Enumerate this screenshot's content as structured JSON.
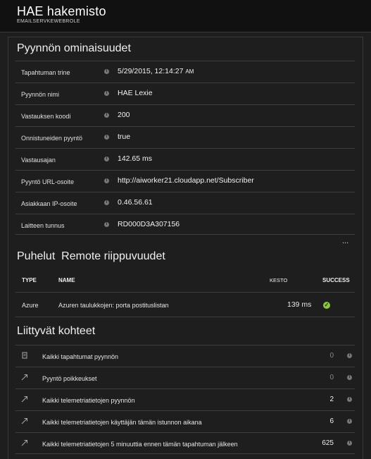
{
  "header": {
    "title": "HAE hakemisto",
    "subtitle": "EMAILSERVKEWEBROLE"
  },
  "properties": {
    "title": "Pyynnön ominaisuudet",
    "rows": [
      {
        "label": "Tapahtuman trine",
        "value": "5/29/2015, 12:14:27",
        "suffix": "AM"
      },
      {
        "label": "Pyynnön nimi",
        "value": "HAE Lexie"
      },
      {
        "label": "Vastauksen koodi",
        "value": "200"
      },
      {
        "label": "Onnistuneiden pyyntö",
        "value": "true"
      },
      {
        "label": "Vastausajan",
        "value": "142.65 ms"
      },
      {
        "label": "Pyyntö URL-osoite",
        "value": "http://aiworker21.cloudapp.net/Subscriber"
      },
      {
        "label": "Asiakkaan IP-osoite",
        "value": "0.46.56.61"
      },
      {
        "label": "Laitteen tunnus",
        "value": "RD000D3A307156"
      }
    ],
    "more": "..."
  },
  "calls": {
    "title_prefix": "Puhelut",
    "title": "Remote riippuvuudet",
    "columns": {
      "type": "TYPE",
      "name": "NAME",
      "duration": "KESTO",
      "success": "SUCCESS"
    },
    "rows": [
      {
        "type": "Azure",
        "name": "Azuren taulukkojen: porta postituslistan",
        "duration": "139 ms",
        "success": "✓"
      }
    ]
  },
  "related": {
    "title": "Liittyvät kohteet",
    "rows": [
      {
        "icon": "document-icon",
        "label": "Kaikki tapahtumat pyynnön",
        "count": "0"
      },
      {
        "icon": "arrow-icon",
        "label": "Pyyntö poikkeukset",
        "count": "0"
      },
      {
        "icon": "arrow-icon",
        "label": "Kaikki telemetriatietojen pyynnön",
        "count": "2"
      },
      {
        "icon": "arrow-icon",
        "label": "Kaikki telemetriatietojen käyttäjän tämän istunnon aikana",
        "count": "6"
      },
      {
        "icon": "arrow-icon",
        "label": "Kaikki telemetriatietojen 5 minuuttia ennen tämän tapahtuman jälkeen",
        "count": "625"
      }
    ]
  },
  "colors": {
    "background": "#1e1e1e",
    "header": "#111111",
    "success": "#8cc63f"
  }
}
